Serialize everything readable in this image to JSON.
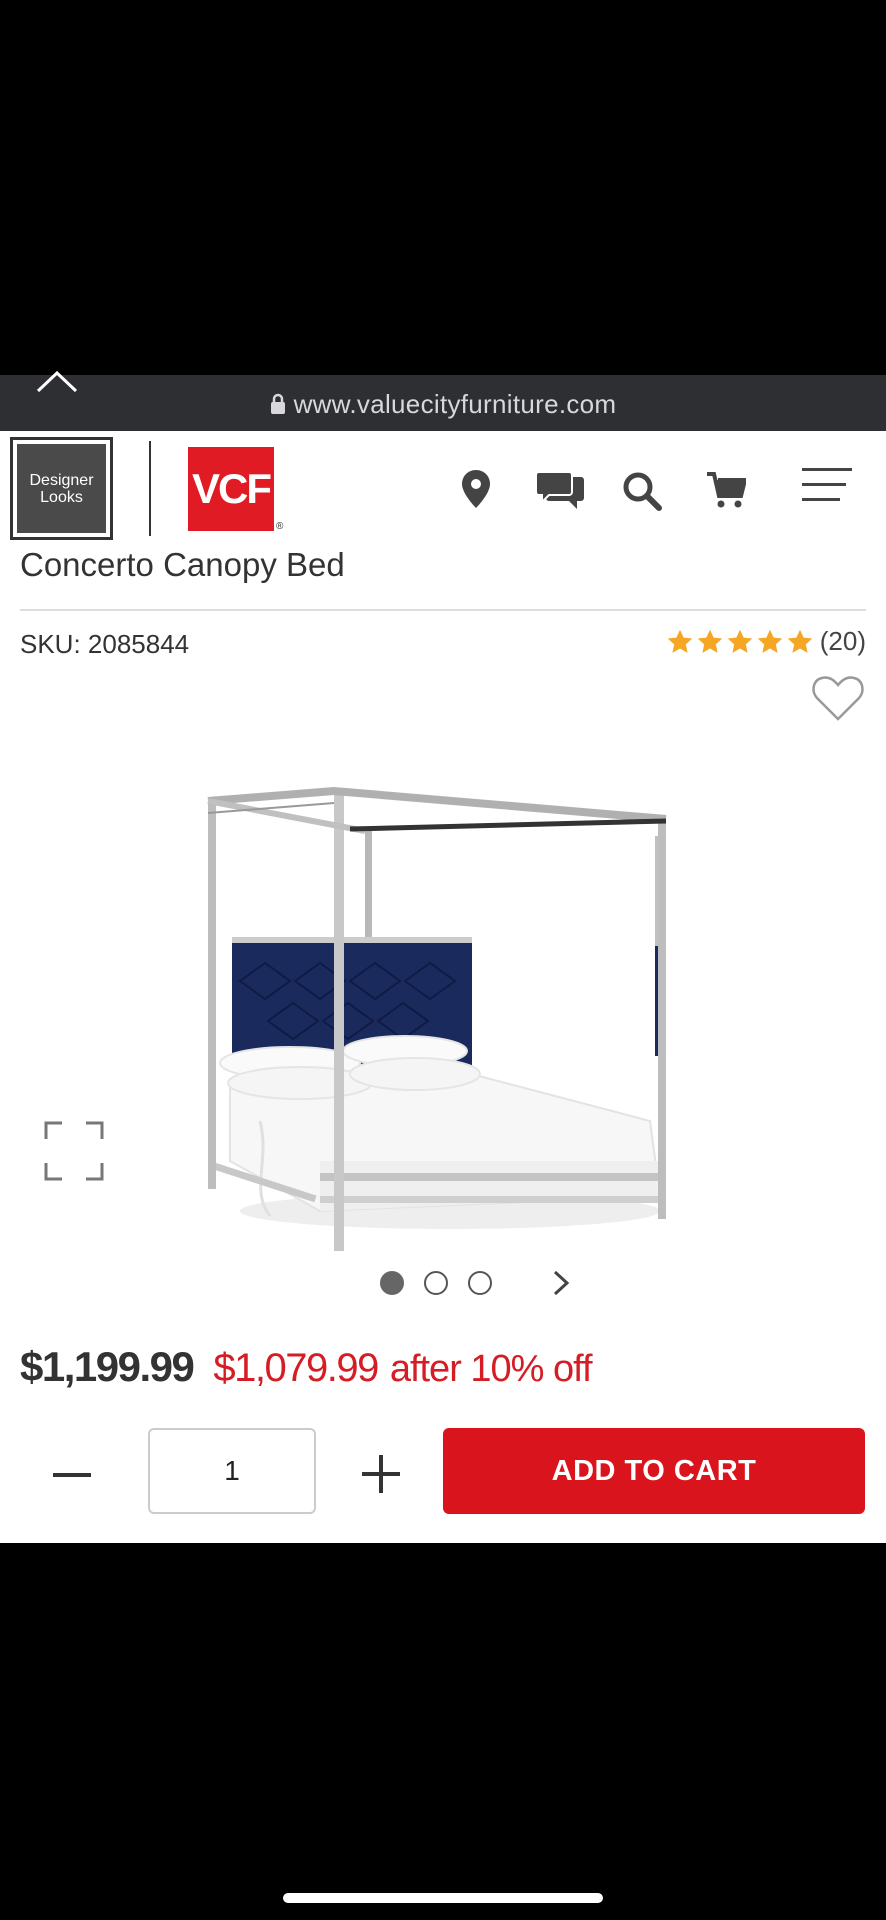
{
  "browser": {
    "url": "www.valuecityfurniture.com"
  },
  "header": {
    "designer_logo_line1": "Designer",
    "designer_logo_line2": "Looks",
    "vcf_logo": "VCF",
    "vcf_reg": "®",
    "icons": [
      "location-pin-icon",
      "chat-icon",
      "search-icon",
      "cart-icon",
      "menu-icon"
    ]
  },
  "product": {
    "title": "Concerto Canopy Bed",
    "sku": "SKU: 2085844",
    "rating_stars": 5,
    "review_count": "(20)",
    "carousel": {
      "total": 3,
      "active": 1
    },
    "price_original": "$1,199.99",
    "price_sale": "$1,079.99",
    "price_note": "after 10% off",
    "quantity": "1",
    "add_to_cart": "ADD TO CART"
  },
  "colors": {
    "brand_red": "#d9141c",
    "star_orange": "#f5a623",
    "headboard_navy": "#1b2a5c"
  }
}
